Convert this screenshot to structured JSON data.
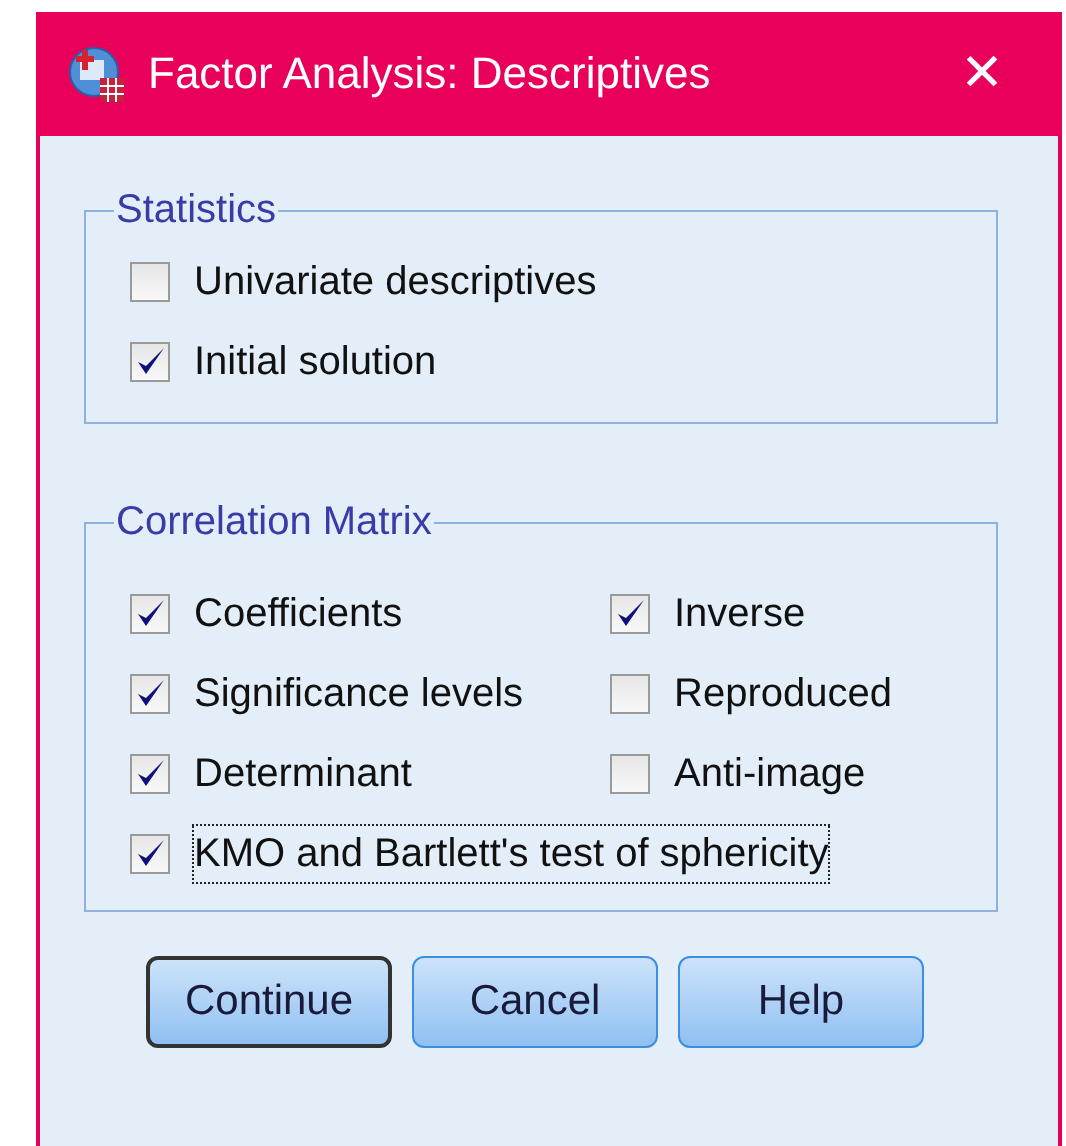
{
  "window": {
    "title": "Factor Analysis: Descriptives",
    "close": "✕"
  },
  "groups": [
    {
      "title": "Statistics",
      "kind": "single",
      "items": [
        {
          "label": "Univariate descriptives",
          "checked": false
        },
        {
          "label": "Initial solution",
          "checked": true
        }
      ]
    },
    {
      "title": "Correlation Matrix",
      "kind": "grid",
      "items": [
        {
          "label": "Coefficients",
          "checked": true
        },
        {
          "label": "Inverse",
          "checked": true
        },
        {
          "label": "Significance levels",
          "checked": true
        },
        {
          "label": "Reproduced",
          "checked": false
        },
        {
          "label": "Determinant",
          "checked": true
        },
        {
          "label": "Anti-image",
          "checked": false
        },
        {
          "label": "KMO and Bartlett's test of sphericity",
          "checked": true,
          "focused": true,
          "wide": true
        }
      ]
    }
  ],
  "buttons": [
    {
      "label": "Continue",
      "default": true
    },
    {
      "label": "Cancel",
      "default": false
    },
    {
      "label": "Help",
      "default": false
    }
  ]
}
